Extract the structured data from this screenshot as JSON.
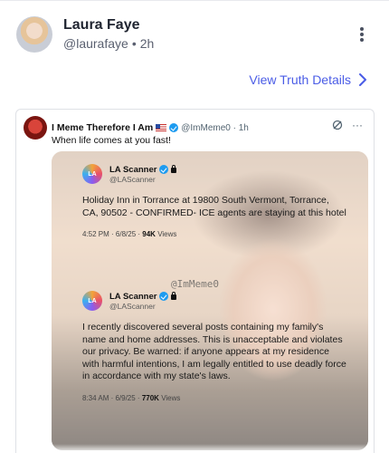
{
  "post": {
    "author_name": "Laura Faye",
    "handle": "@laurafaye",
    "separator": "•",
    "age": "2h",
    "details_label": "View Truth Details"
  },
  "embed": {
    "name": "I Meme Therefore I Am",
    "handle": "@ImMeme0 · 1h",
    "text": "When life comes at you fast!",
    "watermark": "@ImMeme0",
    "cards": [
      {
        "name": "LA Scanner",
        "handle": "@LAScanner",
        "body": "Holiday Inn in Torrance at 19800 South Vermont, Torrance, CA, 90502 - CONFIRMED- ICE agents are staying at this hotel",
        "time": "4:52 PM · 6/8/25 ·",
        "views_count": "94K",
        "views_label": "Views"
      },
      {
        "name": "LA Scanner",
        "handle": "@LAScanner",
        "body": "I recently discovered several posts containing my family's name and home addresses. This is unacceptable and violates our privacy. Be warned: if anyone appears at my residence with harmful intentions, I am legally entitled to use deadly force in accordance with my state's laws.",
        "time": "8:34 AM · 6/9/25 ·",
        "views_count": "770K",
        "views_label": "Views"
      }
    ],
    "logo_text": "LA"
  },
  "colors": {
    "accent": "#4a5ce6",
    "verified": "#1d9bf0"
  },
  "icons": [
    "more-vertical-icon",
    "chevron-right-icon",
    "verified-badge-icon",
    "us-flag-icon",
    "grok-icon",
    "more-horizontal-icon",
    "lock-icon"
  ]
}
